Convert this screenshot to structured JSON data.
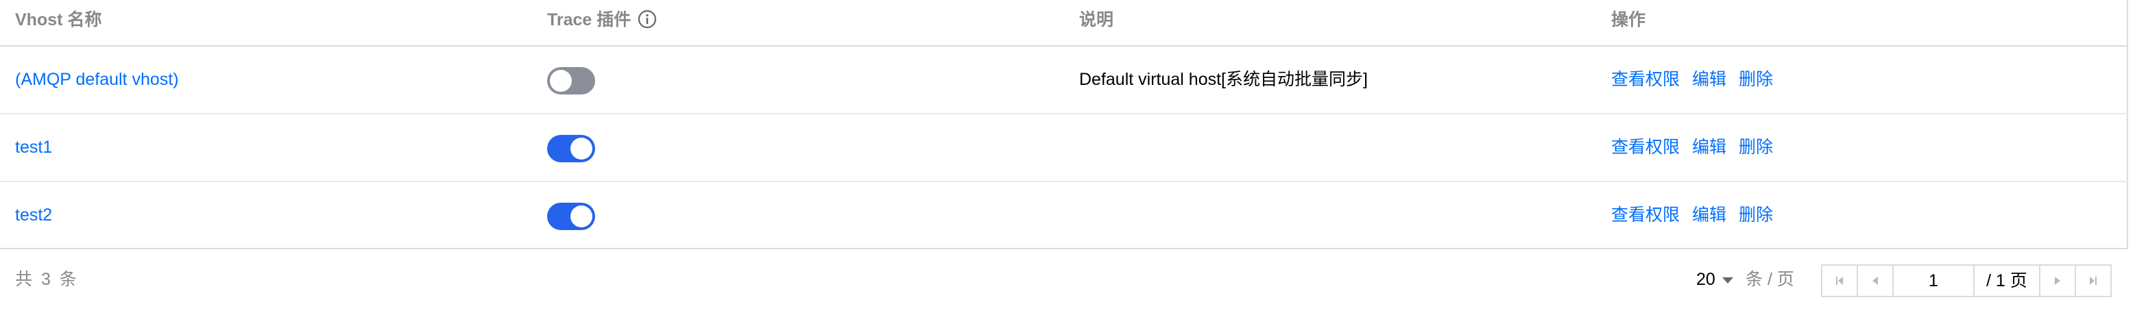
{
  "table": {
    "headers": {
      "vhost_name": "Vhost 名称",
      "trace_plugin": "Trace 插件",
      "description": "说明",
      "actions": "操作"
    },
    "rows": [
      {
        "name": "(AMQP default vhost)",
        "trace_enabled": false,
        "description": "Default virtual host[系统自动批量同步]",
        "actions": [
          "查看权限",
          "编辑",
          "删除"
        ]
      },
      {
        "name": "test1",
        "trace_enabled": true,
        "description": "",
        "actions": [
          "查看权限",
          "编辑",
          "删除"
        ]
      },
      {
        "name": "test2",
        "trace_enabled": true,
        "description": "",
        "actions": [
          "查看权限",
          "编辑",
          "删除"
        ]
      }
    ]
  },
  "footer": {
    "total_text": "共 3 条",
    "page_size": "20",
    "per_page_label": "条 / 页",
    "current_page": "1",
    "total_pages_text": "/ 1 页"
  },
  "colors": {
    "link": "#006eff",
    "toggle_on": "#2563eb",
    "toggle_off": "#8a8f99",
    "header_text": "#888888",
    "border": "#d9dbe0"
  },
  "icons": {
    "info": "info-circle-icon",
    "first_page": "first-page-icon",
    "prev_page": "prev-page-icon",
    "next_page": "next-page-icon",
    "last_page": "last-page-icon",
    "dropdown": "caret-down-icon"
  }
}
